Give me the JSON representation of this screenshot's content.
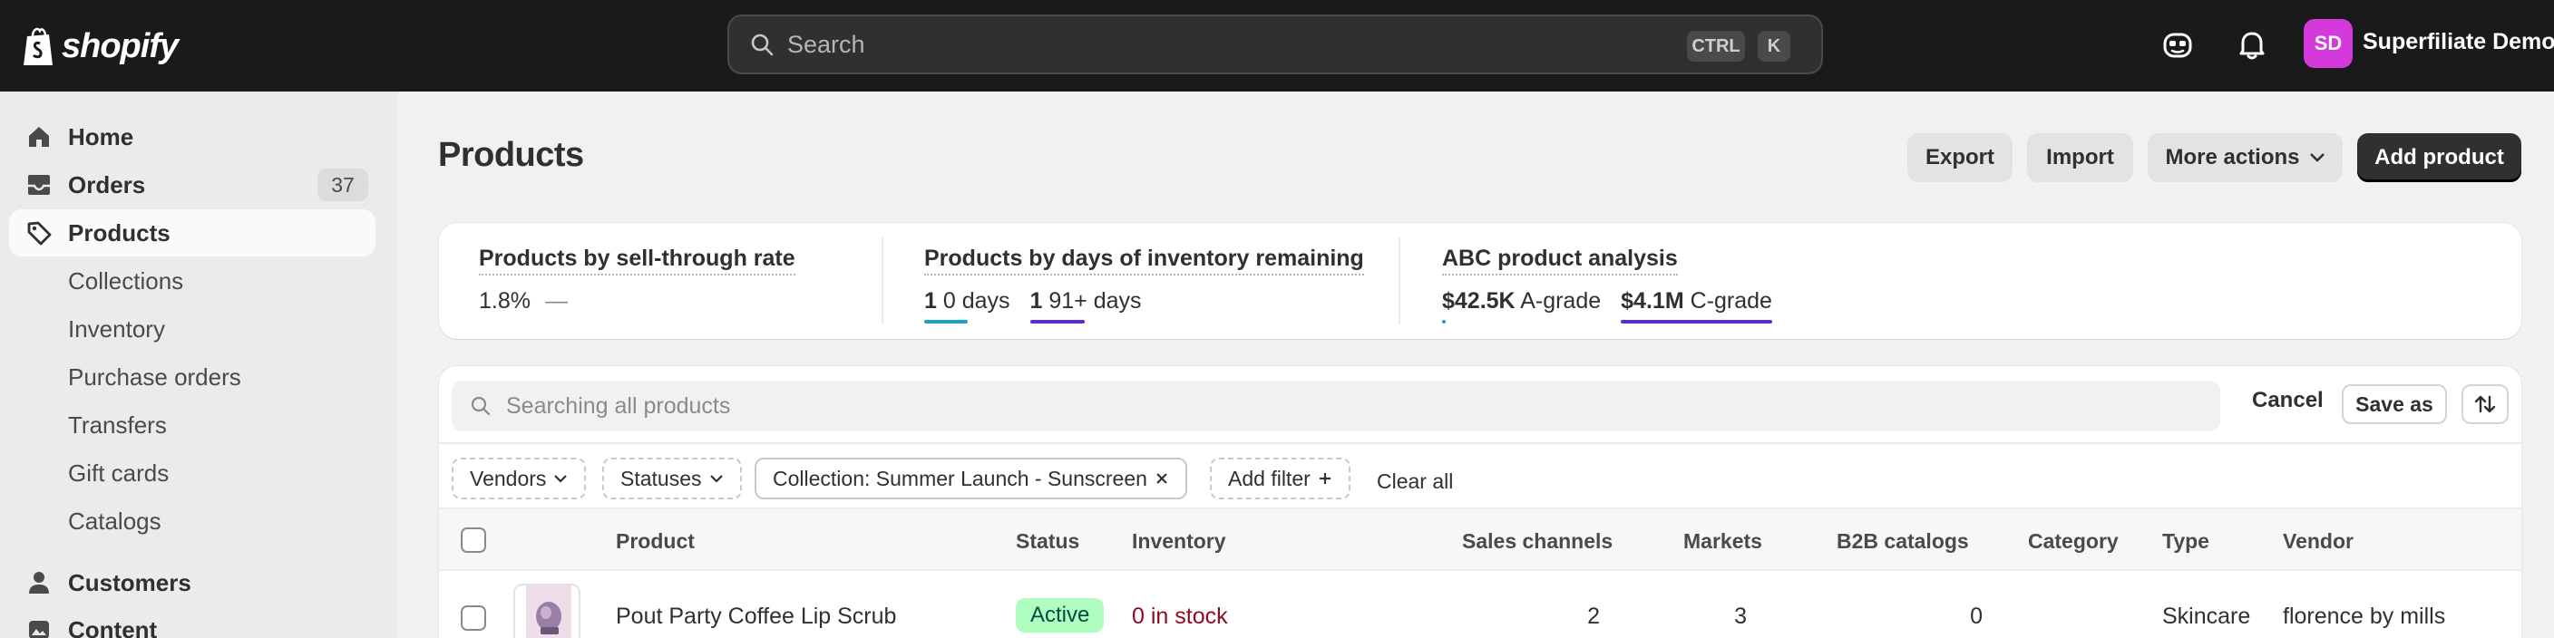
{
  "topbar": {
    "logo_text": "shopify",
    "search_placeholder": "Search",
    "kbd_ctrl": "CTRL",
    "kbd_k": "K",
    "avatar_initials": "SD",
    "account_name": "Superfiliate Demo"
  },
  "sidebar": {
    "items": [
      {
        "label": "Home",
        "icon": "home-icon"
      },
      {
        "label": "Orders",
        "icon": "orders-icon",
        "badge": "37"
      },
      {
        "label": "Products",
        "icon": "tag-icon",
        "active": true
      },
      {
        "label": "Collections"
      },
      {
        "label": "Inventory"
      },
      {
        "label": "Purchase orders"
      },
      {
        "label": "Transfers"
      },
      {
        "label": "Gift cards"
      },
      {
        "label": "Catalogs"
      },
      {
        "label": "Customers",
        "icon": "person-icon"
      },
      {
        "label": "Content",
        "icon": "content-icon"
      }
    ]
  },
  "page": {
    "title": "Products",
    "export_label": "Export",
    "import_label": "Import",
    "more_actions_label": "More actions",
    "add_product_label": "Add product"
  },
  "metrics": {
    "sell_through": {
      "title": "Products by sell-through rate",
      "value": "1.8%",
      "trend": "—"
    },
    "days_inventory": {
      "title": "Products by days of inventory remaining",
      "first_count": "1",
      "first_label": "0 days",
      "second_count": "1",
      "second_label": "91+ days"
    },
    "abc": {
      "title": "ABC product analysis",
      "a_value": "$42.5K",
      "a_label": "A-grade",
      "c_value": "$4.1M",
      "c_label": "C-grade"
    },
    "colors": {
      "teal": "#1ba0c8",
      "purple": "#5b2ad6"
    }
  },
  "table": {
    "search_placeholder": "Searching all products",
    "cancel_label": "Cancel",
    "save_as_label": "Save as",
    "filters": {
      "vendors": "Vendors",
      "statuses": "Statuses",
      "collection": "Collection: Summer Launch - Sunscreen",
      "add_filter": "Add filter",
      "clear_all": "Clear all"
    },
    "columns": [
      "Product",
      "Status",
      "Inventory",
      "Sales channels",
      "Markets",
      "B2B catalogs",
      "Category",
      "Type",
      "Vendor"
    ],
    "rows": [
      {
        "product": "Pout Party Coffee Lip Scrub",
        "status": "Active",
        "inventory": "0 in stock",
        "sales_channels": "2",
        "markets": "3",
        "b2b_catalogs": "0",
        "category": "",
        "type": "Skincare",
        "vendor": "florence by mills"
      }
    ]
  }
}
